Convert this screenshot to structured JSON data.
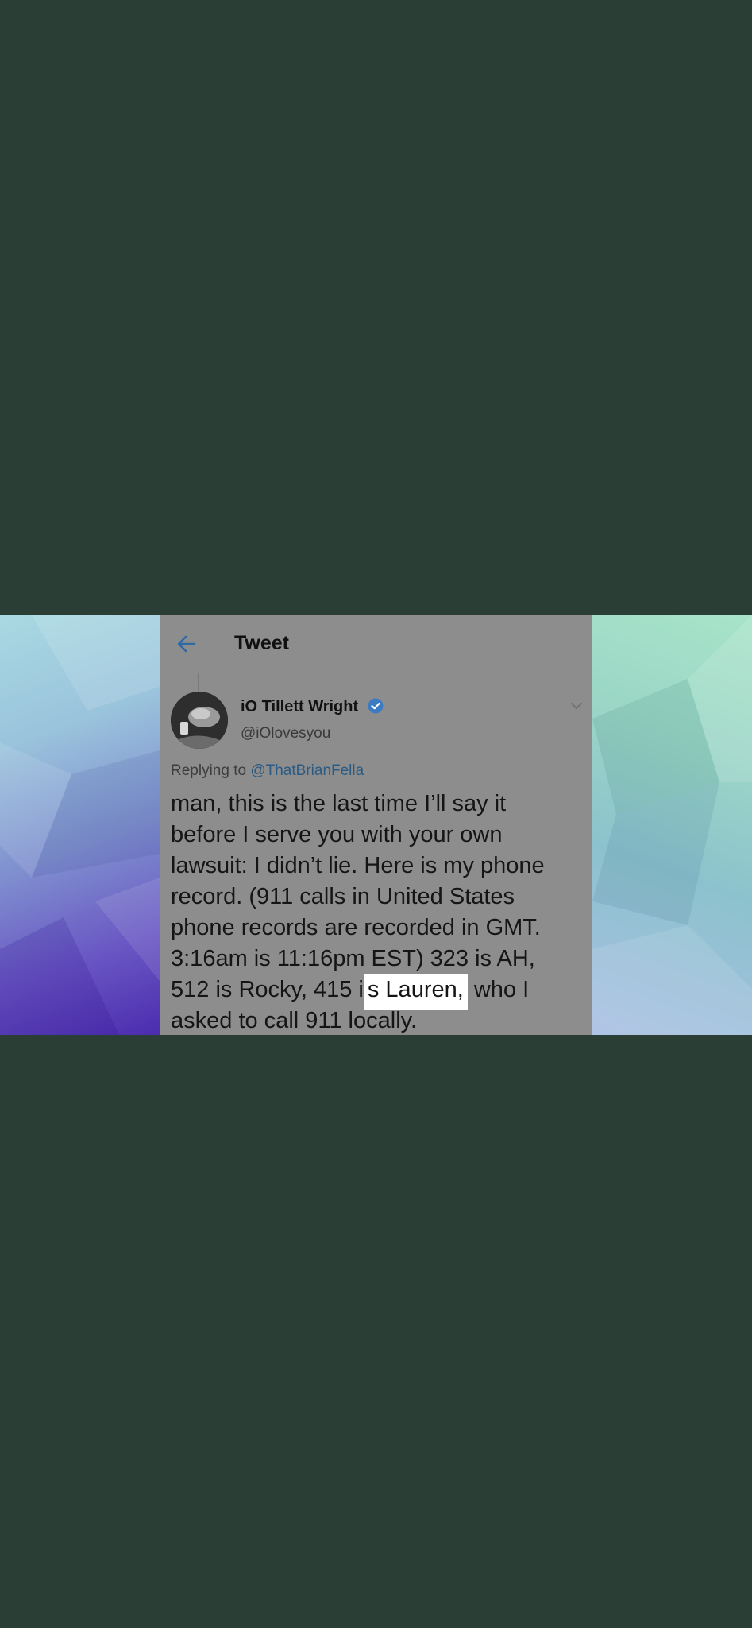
{
  "topbar": {
    "title": "Tweet"
  },
  "tweet": {
    "author_name": "iO Tillett Wright",
    "author_handle": "@iOlovesyou",
    "reply_prefix": "Replying to",
    "reply_mention": "@ThatBrianFella",
    "lines": [
      "man, this is the last time I’ll say it",
      "before I serve you with your own",
      "lawsuit: I didn’t lie. Here is my phone",
      "record. (911 calls in United States",
      "phone records are recorded in GMT.",
      "3:16am is 11:16pm EST) 323 is AH,"
    ],
    "line7_before": "512 is Rocky, 415 i",
    "line7_highlight": "s Lauren,",
    "line7_after": " who I",
    "line8": "asked to call 911 locally."
  },
  "icons": {
    "back": "arrow-left-icon",
    "verified": "verified-badge-icon",
    "more": "chevron-down-icon"
  },
  "colors": {
    "page_background": "#2b3e35",
    "screenshot_background": "#8d8d8d",
    "accent_link": "#2b5b85",
    "verified_badge": "#3b7bc4",
    "highlight": "#ffffff"
  }
}
